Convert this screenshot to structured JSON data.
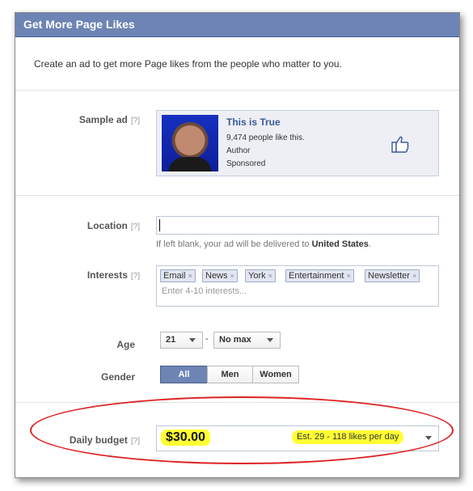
{
  "dialog": {
    "title": "Get More Page Likes",
    "intro": "Create an ad to get more Page likes from the people who matter to you."
  },
  "help_marker": "[?]",
  "sample_ad": {
    "label": "Sample ad",
    "title": "This is True",
    "likes": "9,474 people like this.",
    "category": "Author",
    "sponsored": "Sponsored"
  },
  "location": {
    "label": "Location",
    "value": "",
    "hint_prefix": "If left blank, your ad will be delivered to",
    "hint_country": "United States",
    "hint_suffix": "."
  },
  "interests": {
    "label": "Interests",
    "tokens": [
      "Email",
      "News",
      "York",
      "Entertainment",
      "Newsletter"
    ],
    "remove_glyph": "×",
    "placeholder": "Enter 4-10 interests..."
  },
  "age": {
    "label": "Age",
    "min": "21",
    "separator": "-",
    "max": "No max"
  },
  "gender": {
    "label": "Gender",
    "options": [
      "All",
      "Men",
      "Women"
    ],
    "selected": "All"
  },
  "budget": {
    "label": "Daily budget",
    "amount": "$30.00",
    "estimate": "Est. 29 - 118 likes per day"
  },
  "colors": {
    "header_blue": "#6d84b4",
    "link_blue": "#3b5998",
    "highlight_yellow": "#ffff33",
    "annotation_red": "#dd2222"
  },
  "icons": {
    "thumb": "thumbs-up-icon",
    "dropdown": "chevron-down-icon"
  }
}
